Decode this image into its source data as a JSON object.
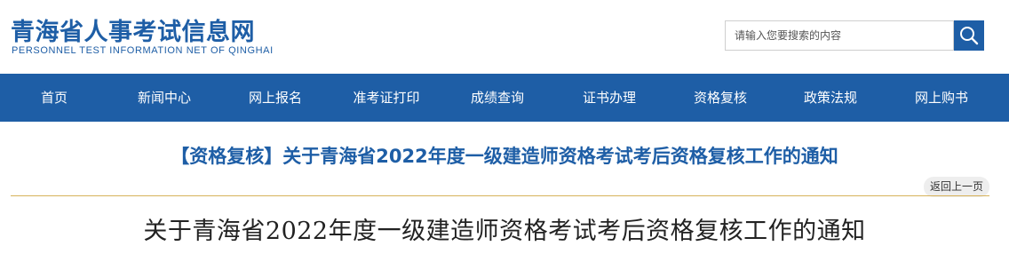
{
  "site": {
    "name_cn": "青海省人事考试信息网",
    "name_en": "PERSONNEL TEST INFORMATION NET OF QINGHAI"
  },
  "search": {
    "placeholder": "请输入您要搜索的内容",
    "icon": "search-icon"
  },
  "nav": {
    "items": [
      "首页",
      "新闻中心",
      "网上报名",
      "准考证打印",
      "成绩查询",
      "证书办理",
      "资格复核",
      "政策法规",
      "网上购书"
    ]
  },
  "article": {
    "title": "【资格复核】关于青海省2022年度一级建造师资格考试考后资格复核工作的通知",
    "back_label": "返回上一页",
    "doc_title": "关于青海省2022年度一级建造师资格考试考后资格复核工作的通知"
  },
  "colors": {
    "brand_blue": "#1e5ea6",
    "divider_gold": "#d7b25a"
  }
}
